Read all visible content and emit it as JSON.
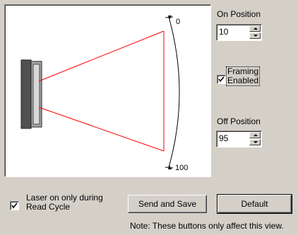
{
  "diagram": {
    "label_top": "0",
    "label_bottom": "100",
    "beam_color": "#ff0000"
  },
  "on_position": {
    "label": "On Position",
    "value": "10"
  },
  "framing": {
    "label_line1": "Framing",
    "label_line2": "Enabled",
    "checked": true
  },
  "off_position": {
    "label": "Off Position",
    "value": "95"
  },
  "laser": {
    "label_line1": "Laser on only during",
    "label_line2": "Read Cycle",
    "checked": true
  },
  "buttons": {
    "send_save": "Send and Save",
    "default": "Default"
  },
  "note": "Note: These buttons only affect this view."
}
